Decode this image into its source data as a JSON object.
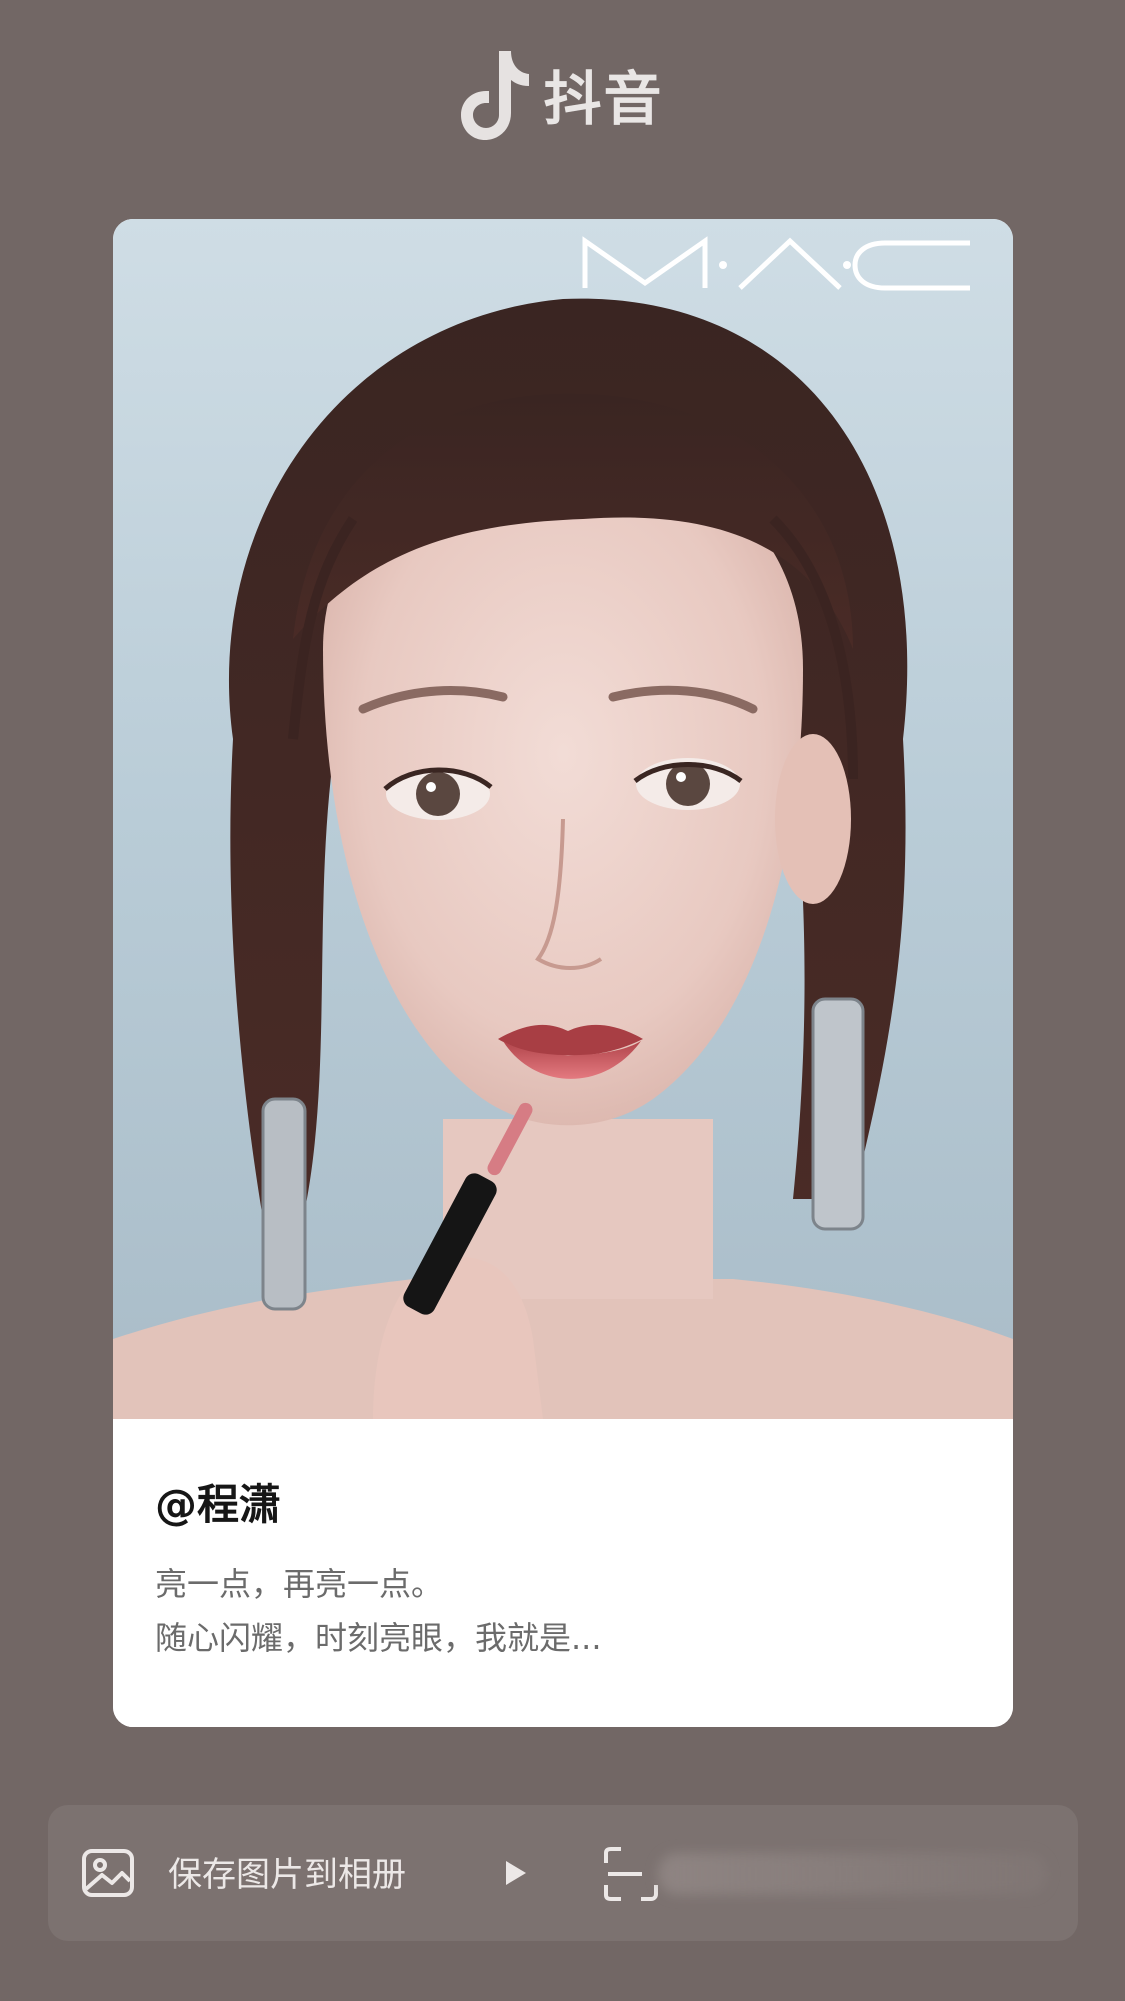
{
  "header": {
    "app_name": "抖音",
    "logo_icon": "tiktok-note-icon"
  },
  "card": {
    "photo_brand_logo": "MAC",
    "username": "@程潇",
    "description_line1": "亮一点，再亮一点。",
    "description_line2": "随心闪耀，时刻亮眼，我就是..."
  },
  "actions": {
    "save_label": "保存图片到相册",
    "save_icon": "image-icon",
    "play_icon": "play-icon",
    "scan_icon": "scan-icon"
  },
  "colors": {
    "background": "#726765",
    "card": "#ffffff",
    "action_bar": "#7c7270"
  }
}
